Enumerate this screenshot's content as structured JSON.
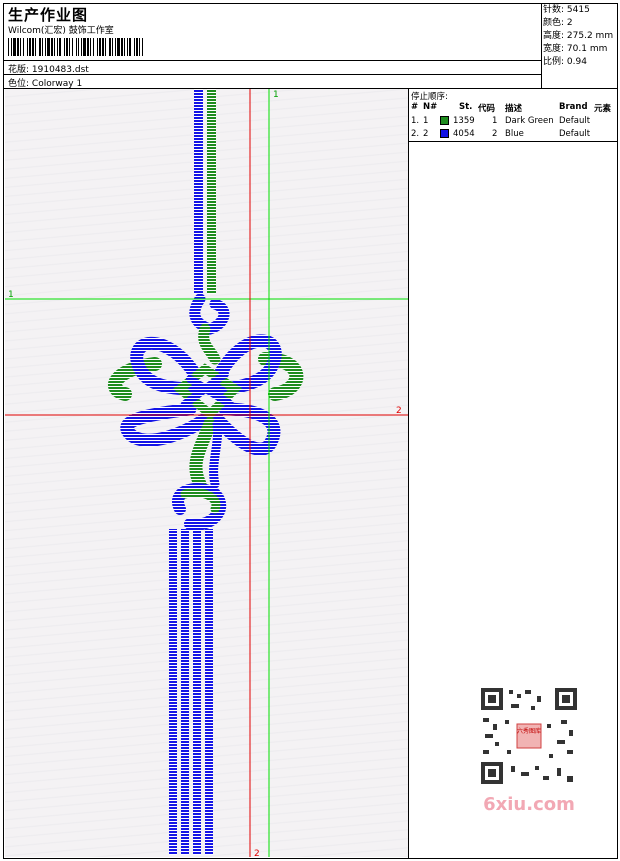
{
  "header": {
    "title": "生产作业图",
    "company": "Wilcom(汇宏) 鼓饰工作室",
    "design_label": "花版:",
    "design_value": "1910483.dst",
    "colorway_label": "色位:",
    "colorway_value": "Colorway 1"
  },
  "properties": [
    {
      "label": "针数:",
      "value": "5415"
    },
    {
      "label": "颜色:",
      "value": "2"
    },
    {
      "label": "高度:",
      "value": "275.2 mm"
    },
    {
      "label": "宽度:",
      "value": "70.1 mm"
    },
    {
      "label": "比例:",
      "value": "0.94"
    }
  ],
  "stop_sequence": {
    "title": "停止顺序:",
    "columns": {
      "num": "#",
      "no": "N#",
      "stitches": "St.",
      "code": "代码",
      "desc": "描述",
      "brand": "Brand",
      "elem": "元素"
    },
    "rows": [
      {
        "num": "1.",
        "no": "1",
        "color": "#1e8c1e",
        "stitches": "1359",
        "code": "1",
        "desc": "Dark Green",
        "brand": "Default"
      },
      {
        "num": "2.",
        "no": "2",
        "color": "#1414e6",
        "stitches": "4054",
        "code": "2",
        "desc": "Blue",
        "brand": "Default"
      }
    ]
  },
  "guides": {
    "h1_label": "1",
    "h2_label": "2",
    "v1_label": "1",
    "v2_label": "2"
  },
  "watermark": {
    "text": "6xiu.com",
    "seal": "六秀图库"
  },
  "colors": {
    "green": "#1e8c1e",
    "blue": "#1414e6",
    "guide_green": "#00e000",
    "guide_red": "#e00000"
  }
}
